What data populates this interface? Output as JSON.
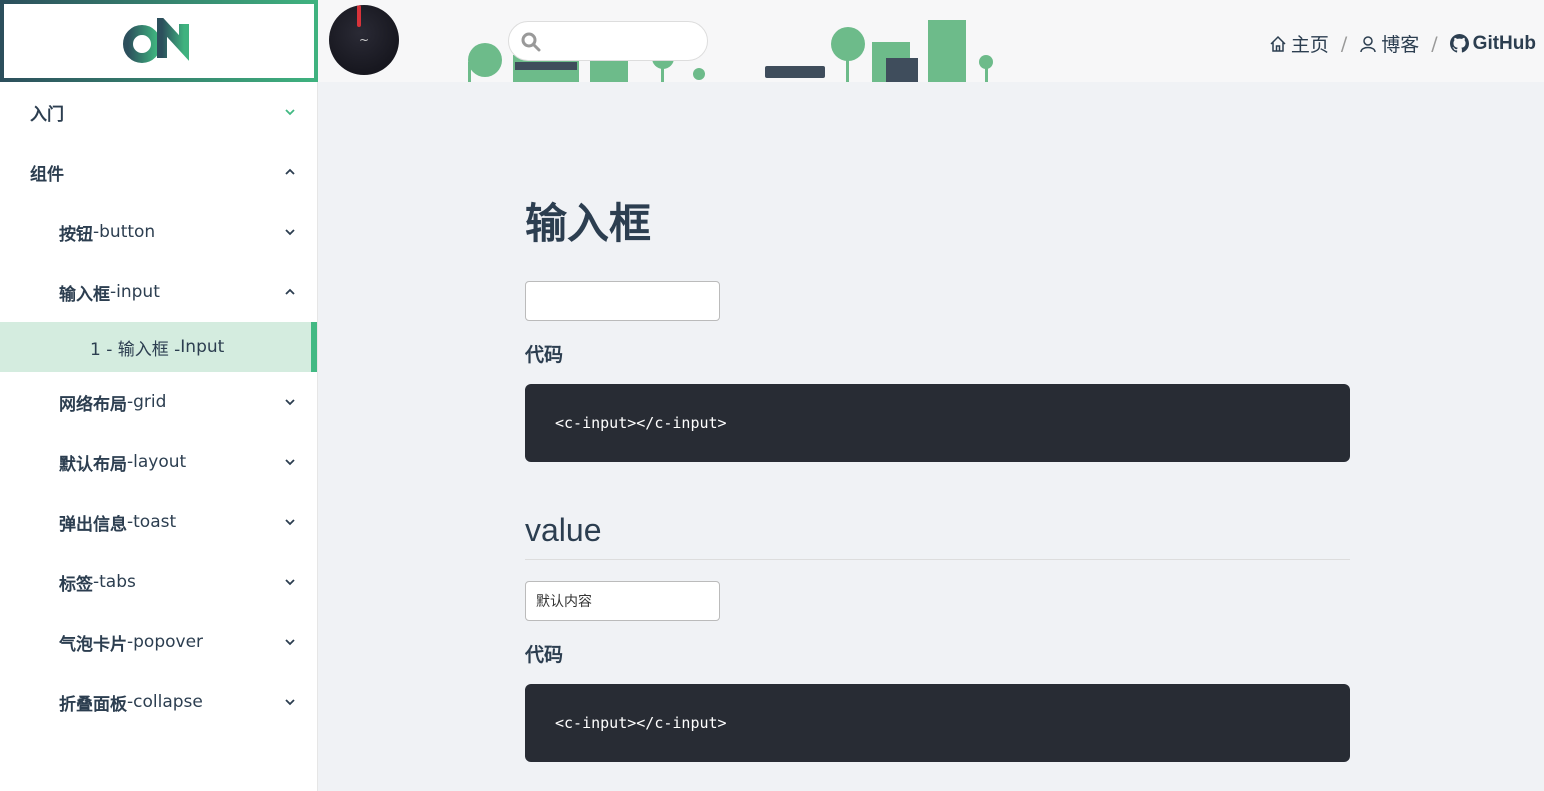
{
  "header": {
    "search": {
      "value": "",
      "placeholder": ""
    },
    "nav": [
      {
        "label": "主页",
        "icon": "home-icon"
      },
      {
        "label": "博客",
        "icon": "user-icon"
      },
      {
        "label": "GitHub",
        "icon": "github-icon"
      }
    ],
    "separator": "/"
  },
  "sidebar": {
    "items": [
      {
        "label": "入门",
        "en": "",
        "level": 1,
        "expanded": false
      },
      {
        "label": "组件",
        "en": "",
        "level": 1,
        "expanded": true
      },
      {
        "label": "按钮",
        "en": "-button",
        "level": 2,
        "expanded": false
      },
      {
        "label": "输入框",
        "en": "-input",
        "level": 2,
        "expanded": true
      },
      {
        "label": "1 - 输入框 - ",
        "en": "Input",
        "level": 3,
        "active": true
      },
      {
        "label": "网络布局",
        "en": "-grid",
        "level": 2,
        "expanded": false
      },
      {
        "label": "默认布局",
        "en": "-layout",
        "level": 2,
        "expanded": false
      },
      {
        "label": "弹出信息",
        "en": "-toast",
        "level": 2,
        "expanded": false
      },
      {
        "label": "标签",
        "en": "-tabs",
        "level": 2,
        "expanded": false
      },
      {
        "label": "气泡卡片",
        "en": "-popover",
        "level": 2,
        "expanded": false
      },
      {
        "label": "折叠面板",
        "en": "-collapse",
        "level": 2,
        "expanded": false
      }
    ]
  },
  "main": {
    "title": "输入框",
    "demo1": {
      "value": "",
      "code_label": "代码",
      "code": "<c-input></c-input>"
    },
    "section2": {
      "heading": "value",
      "demo": {
        "value": "默认内容",
        "code_label": "代码",
        "code": "<c-input></c-input>"
      }
    }
  },
  "colors": {
    "accent": "#42b983",
    "code_bg": "#282c34",
    "active_bg": "#d4ecdf"
  }
}
